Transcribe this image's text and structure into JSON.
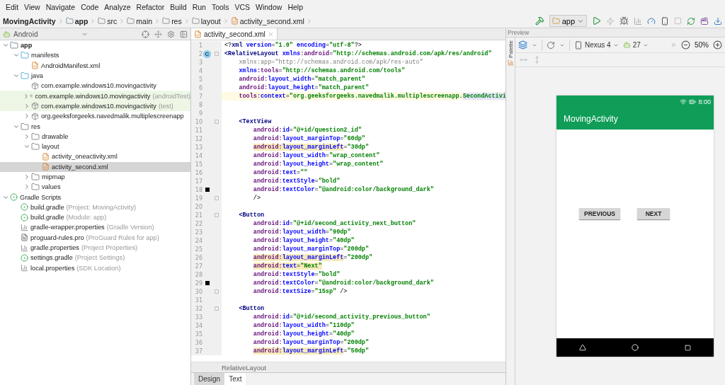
{
  "menu": [
    "Edit",
    "View",
    "Navigate",
    "Code",
    "Analyze",
    "Refactor",
    "Build",
    "Run",
    "Tools",
    "VCS",
    "Window",
    "Help"
  ],
  "breadcrumbs": [
    {
      "label": "MovingActivity",
      "kind": "project"
    },
    {
      "label": "app",
      "kind": "module"
    },
    {
      "label": "src",
      "kind": "folder"
    },
    {
      "label": "main",
      "kind": "folder"
    },
    {
      "label": "res",
      "kind": "resfolder"
    },
    {
      "label": "layout",
      "kind": "folder"
    },
    {
      "label": "activity_second.xml",
      "kind": "xml"
    }
  ],
  "run_config": "app",
  "project_panel": {
    "view": "Android",
    "tree": [
      {
        "label": "app",
        "kind": "module",
        "expanded": true,
        "selected": false,
        "test_source": false,
        "children": [
          {
            "label": "manifests",
            "kind": "sourcefolder",
            "expanded": true,
            "selected": false,
            "test_source": false,
            "children": [
              {
                "label": "AndroidManifest.xml",
                "kind": "manifest",
                "selected": false,
                "test_source": false
              }
            ]
          },
          {
            "label": "java",
            "kind": "sourcefolder",
            "expanded": true,
            "selected": false,
            "test_source": false,
            "children": [
              {
                "label": "com.example.windows10.movingactivity",
                "kind": "package",
                "selected": false,
                "test_source": false
              },
              {
                "label": "com.example.windows10.movingactivity",
                "hint": "(androidTest)",
                "kind": "package",
                "expanded": false,
                "selected": false,
                "test_source": true
              },
              {
                "label": "com.example.windows10.movingactivity",
                "hint": "(test)",
                "kind": "package",
                "expanded": false,
                "selected": false,
                "test_source": true
              },
              {
                "label": "org.geeksforgeeks.navedmalik.multiplescreenapp",
                "kind": "package",
                "expanded": false,
                "selected": false,
                "test_source": false
              }
            ]
          },
          {
            "label": "res",
            "kind": "resfolder",
            "expanded": true,
            "selected": false,
            "test_source": false,
            "children": [
              {
                "label": "drawable",
                "kind": "folder",
                "expanded": false,
                "selected": false,
                "test_source": false
              },
              {
                "label": "layout",
                "kind": "folder",
                "expanded": true,
                "selected": false,
                "test_source": false,
                "children": [
                  {
                    "label": "activity_oneactivity.xml",
                    "kind": "xml",
                    "selected": false,
                    "test_source": false
                  },
                  {
                    "label": "activity_second.xml",
                    "kind": "xml",
                    "selected": true,
                    "test_source": false
                  }
                ]
              },
              {
                "label": "mipmap",
                "kind": "folder",
                "expanded": false,
                "selected": false,
                "test_source": false
              },
              {
                "label": "values",
                "kind": "folder",
                "expanded": false,
                "selected": false,
                "test_source": false
              }
            ]
          }
        ]
      },
      {
        "label": "Gradle Scripts",
        "kind": "gradle",
        "expanded": true,
        "selected": false,
        "test_source": false,
        "children": [
          {
            "label": "build.gradle",
            "hint": "(Project: MovingActivity)",
            "kind": "gradle",
            "selected": false,
            "test_source": false
          },
          {
            "label": "build.gradle",
            "hint": "(Module: app)",
            "kind": "gradle",
            "selected": false,
            "test_source": false
          },
          {
            "label": "gradle-wrapper.properties",
            "hint": "(Gradle Version)",
            "kind": "properties",
            "selected": false,
            "test_source": false
          },
          {
            "label": "proguard-rules.pro",
            "hint": "(ProGuard Rules for app)",
            "kind": "file",
            "selected": false,
            "test_source": false
          },
          {
            "label": "gradle.properties",
            "hint": "(Project Properties)",
            "kind": "properties",
            "selected": false,
            "test_source": false
          },
          {
            "label": "settings.gradle",
            "hint": "(Project Settings)",
            "kind": "gradle",
            "selected": false,
            "test_source": false
          },
          {
            "label": "local.properties",
            "hint": "(SDK Location)",
            "kind": "properties",
            "selected": false,
            "test_source": false
          }
        ]
      }
    ]
  },
  "editor": {
    "tab": "activity_second.xml",
    "lines": [
      {
        "num": "1",
        "fold": false,
        "caret": false,
        "tokens": [
          {
            "kind": "plain",
            "text": "<?"
          },
          {
            "kind": "tag",
            "text": "xml"
          },
          {
            "kind": "attr",
            "text": " version"
          },
          {
            "kind": "plain",
            "text": "="
          },
          {
            "kind": "value",
            "text": "\"1.0\""
          },
          {
            "kind": "attr",
            "text": " encoding"
          },
          {
            "kind": "plain",
            "text": "="
          },
          {
            "kind": "value",
            "text": "\"utf-8\""
          },
          {
            "kind": "plain",
            "text": "?>"
          }
        ]
      },
      {
        "num": "2",
        "fold": true,
        "caret": false,
        "badge": "C",
        "tokens": [
          {
            "kind": "tag",
            "text": "<RelativeLayout"
          },
          {
            "kind": "attr",
            "text": " xmlns"
          },
          {
            "kind": "ns",
            "text": ":android"
          },
          {
            "kind": "plain",
            "text": "="
          },
          {
            "kind": "value",
            "text": "\"http://schemas.android.com/apk/res/android\""
          }
        ]
      },
      {
        "num": "3",
        "fold": false,
        "caret": false,
        "tokens": [
          {
            "kind": "unused",
            "text": "    xmlns:app=\"http://schemas.android.com/apk/res-auto\""
          }
        ]
      },
      {
        "num": "4",
        "fold": false,
        "caret": false,
        "tokens": [
          {
            "kind": "attr",
            "text": "    xmlns"
          },
          {
            "kind": "ns",
            "text": ":tools"
          },
          {
            "kind": "plain",
            "text": "="
          },
          {
            "kind": "value",
            "text": "\"http://schemas.android.com/tools\""
          }
        ]
      },
      {
        "num": "5",
        "fold": false,
        "caret": false,
        "tokens": [
          {
            "kind": "ns",
            "text": "    android:"
          },
          {
            "kind": "attr",
            "text": "layout_width"
          },
          {
            "kind": "plain",
            "text": "="
          },
          {
            "kind": "value",
            "text": "\"match_parent\""
          }
        ]
      },
      {
        "num": "6",
        "fold": false,
        "caret": false,
        "tokens": [
          {
            "kind": "ns",
            "text": "    android:"
          },
          {
            "kind": "attr",
            "text": "layout_height"
          },
          {
            "kind": "plain",
            "text": "="
          },
          {
            "kind": "value",
            "text": "\"match_parent\""
          }
        ]
      },
      {
        "num": "7",
        "fold": false,
        "caret": true,
        "tokens": [
          {
            "kind": "ns",
            "text": "    tools:"
          },
          {
            "kind": "attr",
            "text": "context"
          },
          {
            "kind": "plain",
            "text": "="
          },
          {
            "kind": "value",
            "text": "\"org.geeksforgeeks.navedmalik.multiplescreenapp."
          },
          {
            "kind": "value",
            "text": "SecondActivi",
            "color": "#e4e4ff"
          }
        ]
      },
      {
        "num": "8",
        "fold": false,
        "caret": false
      },
      {
        "num": "9",
        "fold": false,
        "caret": false
      },
      {
        "num": "10",
        "fold": true,
        "caret": false,
        "tokens": [
          {
            "kind": "tag",
            "text": "    <TextView"
          }
        ]
      },
      {
        "num": "11",
        "fold": false,
        "caret": false,
        "tokens": [
          {
            "kind": "ns",
            "text": "        android:"
          },
          {
            "kind": "attr",
            "text": "id"
          },
          {
            "kind": "plain",
            "text": "="
          },
          {
            "kind": "value",
            "text": "\"@+id/question2_id\""
          }
        ]
      },
      {
        "num": "12",
        "fold": false,
        "caret": false,
        "tokens": [
          {
            "kind": "ns",
            "text": "        android:"
          },
          {
            "kind": "attr",
            "text": "layout_marginTop"
          },
          {
            "kind": "plain",
            "text": "="
          },
          {
            "kind": "value",
            "text": "\"60dp\""
          }
        ]
      },
      {
        "num": "13",
        "fold": false,
        "caret": false,
        "tokens": [
          {
            "kind": "ns",
            "text": "        android:",
            "color": "#f6ebbc"
          },
          {
            "kind": "attr",
            "text": "layout_marginLeft",
            "color": "#f6ebbc"
          },
          {
            "kind": "plain",
            "text": "="
          },
          {
            "kind": "value",
            "text": "\"30dp\""
          }
        ]
      },
      {
        "num": "14",
        "fold": false,
        "caret": false,
        "tokens": [
          {
            "kind": "ns",
            "text": "        android:"
          },
          {
            "kind": "attr",
            "text": "layout_width"
          },
          {
            "kind": "plain",
            "text": "="
          },
          {
            "kind": "value",
            "text": "\"wrap_content\""
          }
        ]
      },
      {
        "num": "15",
        "fold": false,
        "caret": false,
        "tokens": [
          {
            "kind": "ns",
            "text": "        android:"
          },
          {
            "kind": "attr",
            "text": "layout_height"
          },
          {
            "kind": "plain",
            "text": "="
          },
          {
            "kind": "value",
            "text": "\"wrap_content\""
          }
        ]
      },
      {
        "num": "16",
        "fold": false,
        "caret": false,
        "tokens": [
          {
            "kind": "ns",
            "text": "        android:"
          },
          {
            "kind": "attr",
            "text": "text"
          },
          {
            "kind": "plain",
            "text": "="
          },
          {
            "kind": "value",
            "text": "\"\""
          }
        ]
      },
      {
        "num": "17",
        "fold": false,
        "caret": false,
        "tokens": [
          {
            "kind": "ns",
            "text": "        android:"
          },
          {
            "kind": "attr",
            "text": "textStyle"
          },
          {
            "kind": "plain",
            "text": "="
          },
          {
            "kind": "value",
            "text": "\"bold\""
          }
        ]
      },
      {
        "num": "18",
        "fold": false,
        "caret": false,
        "color": "#000000",
        "tokens": [
          {
            "kind": "ns",
            "text": "        android:"
          },
          {
            "kind": "attr",
            "text": "textColor"
          },
          {
            "kind": "plain",
            "text": "="
          },
          {
            "kind": "value",
            "text": "\"@android:color/background_dark\""
          }
        ]
      },
      {
        "num": "19",
        "fold": true,
        "caret": false,
        "tokens": [
          {
            "kind": "plain",
            "text": "        />"
          }
        ]
      },
      {
        "num": "20",
        "fold": false,
        "caret": false
      },
      {
        "num": "21",
        "fold": true,
        "caret": false,
        "tokens": [
          {
            "kind": "tag",
            "text": "    <Button"
          }
        ]
      },
      {
        "num": "22",
        "fold": false,
        "caret": false,
        "tokens": [
          {
            "kind": "ns",
            "text": "        android:"
          },
          {
            "kind": "attr",
            "text": "id"
          },
          {
            "kind": "plain",
            "text": "="
          },
          {
            "kind": "value",
            "text": "\"@+id/second_activity_next_button\""
          }
        ]
      },
      {
        "num": "23",
        "fold": false,
        "caret": false,
        "tokens": [
          {
            "kind": "ns",
            "text": "        android:"
          },
          {
            "kind": "attr",
            "text": "layout_width"
          },
          {
            "kind": "plain",
            "text": "="
          },
          {
            "kind": "value",
            "text": "\"90dp\""
          }
        ]
      },
      {
        "num": "24",
        "fold": false,
        "caret": false,
        "tokens": [
          {
            "kind": "ns",
            "text": "        android:"
          },
          {
            "kind": "attr",
            "text": "layout_height"
          },
          {
            "kind": "plain",
            "text": "="
          },
          {
            "kind": "value",
            "text": "\"40dp\""
          }
        ]
      },
      {
        "num": "25",
        "fold": false,
        "caret": false,
        "tokens": [
          {
            "kind": "ns",
            "text": "        android:"
          },
          {
            "kind": "attr",
            "text": "layout_marginTop"
          },
          {
            "kind": "plain",
            "text": "="
          },
          {
            "kind": "value",
            "text": "\"200dp\""
          }
        ]
      },
      {
        "num": "26",
        "fold": false,
        "caret": false,
        "tokens": [
          {
            "kind": "ns",
            "text": "        android:",
            "color": "#f6ebbc"
          },
          {
            "kind": "attr",
            "text": "layout_marginLeft",
            "color": "#f6ebbc"
          },
          {
            "kind": "plain",
            "text": "="
          },
          {
            "kind": "value",
            "text": "\"200dp\""
          }
        ]
      },
      {
        "num": "27",
        "fold": false,
        "caret": false,
        "tokens": [
          {
            "kind": "ns",
            "text": "        android:",
            "color": "#f6ebbc"
          },
          {
            "kind": "attr",
            "text": "text",
            "color": "#f6ebbc"
          },
          {
            "kind": "plain",
            "text": "=",
            "color": "#f6ebbc"
          },
          {
            "kind": "value",
            "text": "\"Next\"",
            "color": "#f6ebbc"
          }
        ]
      },
      {
        "num": "28",
        "fold": false,
        "caret": false,
        "tokens": [
          {
            "kind": "ns",
            "text": "        android:"
          },
          {
            "kind": "attr",
            "text": "textStyle"
          },
          {
            "kind": "plain",
            "text": "="
          },
          {
            "kind": "value",
            "text": "\"bold\""
          }
        ]
      },
      {
        "num": "29",
        "fold": false,
        "caret": false,
        "color": "#000000",
        "tokens": [
          {
            "kind": "ns",
            "text": "        android:"
          },
          {
            "kind": "attr",
            "text": "textColor"
          },
          {
            "kind": "plain",
            "text": "="
          },
          {
            "kind": "value",
            "text": "\"@android:color/background_dark\""
          }
        ]
      },
      {
        "num": "30",
        "fold": true,
        "caret": false,
        "tokens": [
          {
            "kind": "ns",
            "text": "        android:"
          },
          {
            "kind": "attr",
            "text": "textSize"
          },
          {
            "kind": "plain",
            "text": "="
          },
          {
            "kind": "value",
            "text": "\"15sp\""
          },
          {
            "kind": "plain",
            "text": " />"
          }
        ]
      },
      {
        "num": "31",
        "fold": false,
        "caret": false
      },
      {
        "num": "32",
        "fold": true,
        "caret": false,
        "tokens": [
          {
            "kind": "tag",
            "text": "    <Button"
          }
        ]
      },
      {
        "num": "33",
        "fold": false,
        "caret": false,
        "tokens": [
          {
            "kind": "ns",
            "text": "        android:"
          },
          {
            "kind": "attr",
            "text": "id"
          },
          {
            "kind": "plain",
            "text": "="
          },
          {
            "kind": "value",
            "text": "\"@+id/second_activity_previous_button\""
          }
        ]
      },
      {
        "num": "34",
        "fold": false,
        "caret": false,
        "tokens": [
          {
            "kind": "ns",
            "text": "        android:"
          },
          {
            "kind": "attr",
            "text": "layout_width"
          },
          {
            "kind": "plain",
            "text": "="
          },
          {
            "kind": "value",
            "text": "\"110dp\""
          }
        ]
      },
      {
        "num": "35",
        "fold": false,
        "caret": false,
        "tokens": [
          {
            "kind": "ns",
            "text": "        android:"
          },
          {
            "kind": "attr",
            "text": "layout_height"
          },
          {
            "kind": "plain",
            "text": "="
          },
          {
            "kind": "value",
            "text": "\"40dp\""
          }
        ]
      },
      {
        "num": "36",
        "fold": false,
        "caret": false,
        "tokens": [
          {
            "kind": "ns",
            "text": "        android:"
          },
          {
            "kind": "attr",
            "text": "layout_marginTop"
          },
          {
            "kind": "plain",
            "text": "="
          },
          {
            "kind": "value",
            "text": "\"200dp\""
          }
        ]
      },
      {
        "num": "37",
        "fold": false,
        "caret": false,
        "tokens": [
          {
            "kind": "ns",
            "text": "        android:",
            "color": "#f6ebbc"
          },
          {
            "kind": "attr",
            "text": "layout_marginLeft",
            "color": "#f6ebbc"
          },
          {
            "kind": "plain",
            "text": "="
          },
          {
            "kind": "value",
            "text": "\"50dp\""
          }
        ]
      }
    ],
    "path": "RelativeLayout",
    "tabs": [
      {
        "label": "Design",
        "selected": false
      },
      {
        "label": "Text",
        "selected": true
      }
    ]
  },
  "preview": {
    "title": "Preview",
    "palette": "Palette",
    "device": "Nexus 4",
    "api": "27",
    "zoom": "50%",
    "phone": {
      "time": "8:00",
      "app_title": "MovingActivity",
      "buttons": [
        "PREVIOUS",
        "NEXT"
      ]
    }
  }
}
